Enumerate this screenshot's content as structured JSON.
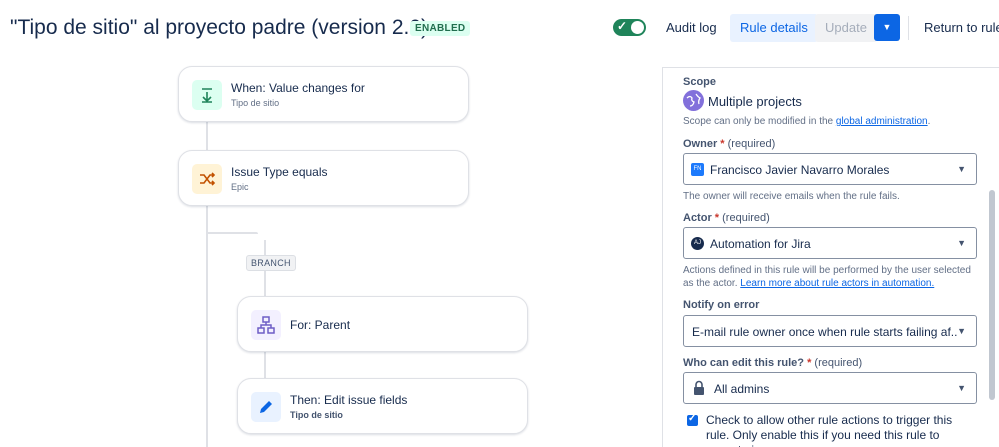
{
  "header": {
    "title": "\"Tipo de sitio\" al proyecto padre (version 2.0)",
    "status_badge": "ENABLED",
    "audit_log": "Audit log",
    "rule_details": "Rule details",
    "update": "Update",
    "return": "Return to rules"
  },
  "flow": {
    "trigger": {
      "title": "When: Value changes for",
      "subtitle": "Tipo de sitio",
      "icon": "trigger-down-arrow-icon"
    },
    "condition": {
      "title": "Issue Type equals",
      "subtitle": "Epic",
      "icon": "shuffle-icon"
    },
    "branch_label": "BRANCH",
    "branch": {
      "title": "For: Parent",
      "icon": "hierarchy-icon"
    },
    "action": {
      "title": "Then: Edit issue fields",
      "subtitle": "Tipo de sitio",
      "icon": "pencil-icon"
    }
  },
  "panel": {
    "scope_label": "Scope",
    "scope_value": "Multiple projects",
    "scope_help": "Scope can only be modified in the",
    "scope_help_link": "global administration",
    "owner_label": "Owner",
    "owner_required": "(required)",
    "owner_initials": "FN",
    "owner_value": "Francisco Javier Navarro Morales",
    "owner_help": "The owner will receive emails when the rule fails.",
    "actor_label": "Actor",
    "actor_required": "(required)",
    "actor_initials": "AJ",
    "actor_value": "Automation for Jira",
    "actor_help": "Actions defined in this rule will be performed by the user selected as the actor.",
    "actor_help_link": "Learn more about rule actors in automation.",
    "notify_label": "Notify on error",
    "notify_value": "E-mail rule owner once when rule starts failing af...",
    "edit_label": "Who can edit this rule?",
    "edit_required": "(required)",
    "edit_value": "All admins",
    "checkbox_text": "Check to allow other rule actions to trigger this rule. Only enable this if you need this rule to execute in"
  },
  "colors": {
    "accent": "#0c66e4",
    "toggle_on": "#1f845a",
    "trigger_bg": "#dcfff1",
    "condition_bg": "#fff3d6",
    "branch_bg": "#f3f0ff",
    "action_bg": "#e9f2ff"
  }
}
